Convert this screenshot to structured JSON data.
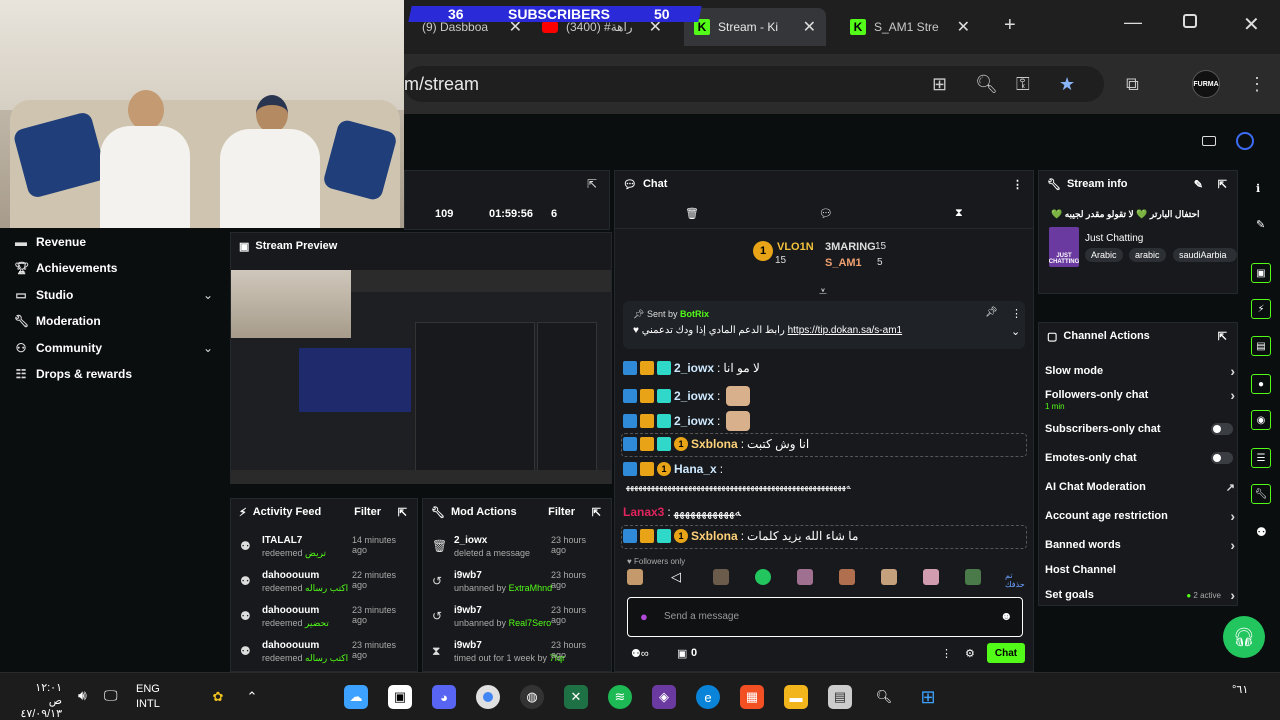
{
  "browser": {
    "tabs": [
      {
        "label": "(9) Dasbboa"
      },
      {
        "label": "(3400) #راهة"
      },
      {
        "label": "Stream - Ki"
      },
      {
        "label": "S_AM1 Stre"
      }
    ],
    "url": "m/stream",
    "profile_label": "FURMA",
    "new_tab_glyph": "+"
  },
  "subscribers_overlay": {
    "left_count": "36",
    "label": "SUBSCRIBERS",
    "right_count": "50"
  },
  "stats": {
    "viewers": "109",
    "duration": "01:59:56",
    "count": "6"
  },
  "sidebar": {
    "items": [
      {
        "label": "Revenue"
      },
      {
        "label": "Achievements"
      },
      {
        "label": "Studio"
      },
      {
        "label": "Moderation"
      },
      {
        "label": "Community"
      },
      {
        "label": "Drops & rewards"
      }
    ]
  },
  "stream_preview": {
    "title": "Stream Preview"
  },
  "activity_feed": {
    "title": "Activity Feed",
    "filter_label": "Filter",
    "items": [
      {
        "user": "ITALAL7",
        "action": "redeemed",
        "reward": "تريض",
        "time": "14 minutes ago"
      },
      {
        "user": "dahooouum",
        "action": "redeemed",
        "reward": "اكتب رساله",
        "time": "22 minutes ago"
      },
      {
        "user": "dahooouum",
        "action": "redeemed",
        "reward": "تحضير",
        "time": "23 minutes ago"
      },
      {
        "user": "dahooouum",
        "action": "redeemed",
        "reward": "اكتب رساله",
        "time": "23 minutes ago"
      }
    ]
  },
  "mod_actions": {
    "title": "Mod Actions",
    "filter_label": "Filter",
    "items": [
      {
        "user": "2_iowx",
        "action": "deleted a message",
        "by": "",
        "time": "23 hours ago"
      },
      {
        "user": "i9wb7",
        "action": "unbanned by",
        "by": "ExtraMhnd",
        "time": "23 hours ago"
      },
      {
        "user": "i9wb7",
        "action": "unbanned by",
        "by": "Real7Sero",
        "time": "23 hours ago"
      },
      {
        "user": "i9wb7",
        "action": "timed out for 1 week by",
        "by": "7fqr",
        "time": "23 hours ago"
      }
    ]
  },
  "chat": {
    "title": "Chat",
    "leaderboard": [
      {
        "name": "VLO1N",
        "count": "15"
      },
      {
        "name": "3MARING",
        "count": "15"
      },
      {
        "name": "S_AM1",
        "count": "5"
      }
    ],
    "leader_rank": "1",
    "pinned": {
      "sent_by_label": "Sent by",
      "sender": "BotRix",
      "text": "رابط الدعم المادي إذا ودك تدعمني",
      "link": "https://tip.dokan.sa/s-am1"
    },
    "messages": [
      {
        "user": "2_iowx",
        "text": "لا مو انا"
      },
      {
        "user": "2_iowx",
        "text": ""
      },
      {
        "user": "2_iowx",
        "text": ""
      },
      {
        "user": "Sxblona",
        "text": "انا وش كتبت"
      },
      {
        "user": "Hana_x",
        "text": ""
      },
      {
        "user": "",
        "text": "ﻪﻬﻬﻬﻬﻬﻬﻬﻬﻬﻬﻬﻬﻬﻬﻬﻬﻬﻬﻬﻬﻬﻬﻬﻬﻬﻬﻬﻬﻬﻬﻬﻬﻬﻬﻬﻬﻬﻬﻬﻬﻬﻬﻬﻬﻬﻬﻬﻬﻬﻬﻬﻬﻬ"
      },
      {
        "user": "Lanax3",
        "text": "ﻪﻬﻬﻬﻬﻬﻬﻬﻬﻬﻬﻬ"
      },
      {
        "user": "Sxblona",
        "text": "ما شاء الله يزيد كلمات"
      }
    ],
    "followers_only_label": "Followers only",
    "emote_extra_label": "تم حذفك",
    "input_placeholder": "Send a message",
    "footer_count": "0",
    "send_label": "Chat"
  },
  "stream_info": {
    "title": "Stream info",
    "stream_title": "احتفال البارتر 💚 لا تقولو مقدر لجيبه 💚",
    "category": "Just Chatting",
    "category_art_text": "JUST CHATTING",
    "tags": [
      "Arabic",
      "arabic",
      "saudiAarbia"
    ]
  },
  "channel_actions": {
    "title": "Channel Actions",
    "rows": [
      {
        "label": "Slow mode",
        "sub": "",
        "control": "chevron"
      },
      {
        "label": "Followers-only chat",
        "sub": "1 min",
        "control": "chevron"
      },
      {
        "label": "Subscribers-only chat",
        "sub": "",
        "control": "toggle"
      },
      {
        "label": "Emotes-only chat",
        "sub": "",
        "control": "toggle"
      },
      {
        "label": "AI Chat Moderation",
        "sub": "",
        "control": "external"
      },
      {
        "label": "Account age restriction",
        "sub": "",
        "control": "chevron"
      },
      {
        "label": "Banned words",
        "sub": "",
        "control": "chevron"
      },
      {
        "label": "Host Channel",
        "sub": "",
        "control": "none"
      },
      {
        "label": "Set goals",
        "sub": "",
        "control": "chevron",
        "status": "2 active"
      }
    ]
  },
  "taskbar": {
    "time": "١٢:٠١ ص",
    "date": "٤٧/٠٩/١٣",
    "lang_top": "ENG",
    "lang_bottom": "INTL",
    "weather": "°٦١"
  },
  "colors": {
    "accent": "#53fc18",
    "panel": "#17191c",
    "background": "#0b0e0f"
  }
}
